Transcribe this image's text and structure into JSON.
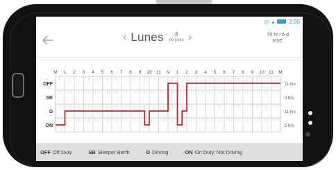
{
  "status_bar": {
    "time": "2:50",
    "icons": [
      "alarm-icon",
      "signal-icon",
      "battery-icon"
    ]
  },
  "header": {
    "day": "Lunes",
    "date_day": "8",
    "date_month": "de junio",
    "cycle_rule": "70 hr / 6 d",
    "timezone": "EST"
  },
  "log_chart": {
    "hour_labels": [
      "M",
      "1",
      "2",
      "3",
      "4",
      "5",
      "6",
      "7",
      "8",
      "9",
      "10",
      "11",
      "N",
      "1",
      "2",
      "3",
      "4",
      "5",
      "6",
      "7",
      "8",
      "9",
      "10",
      "11",
      "M"
    ],
    "row_labels": [
      "OFF",
      "SB",
      "D",
      "ON"
    ],
    "row_totals": [
      "11 hrs",
      "0 hrs",
      "11 hrs",
      "2 hrs"
    ],
    "status_segments": [
      {
        "status": "ON",
        "start": 0,
        "end": 1
      },
      {
        "status": "D",
        "start": 1,
        "end": 9.5
      },
      {
        "status": "ON",
        "start": 9.5,
        "end": 10
      },
      {
        "status": "D",
        "start": 10,
        "end": 12
      },
      {
        "status": "OFF",
        "start": 12,
        "end": 13
      },
      {
        "status": "ON",
        "start": 13,
        "end": 13.5
      },
      {
        "status": "D",
        "start": 13.5,
        "end": 14
      },
      {
        "status": "OFF",
        "start": 14,
        "end": 24
      }
    ],
    "line_color": "#c8232c"
  },
  "legend": [
    {
      "code": "OFF",
      "label": "Off Duty"
    },
    {
      "code": "SB",
      "label": "Sleeper Berth"
    },
    {
      "code": "D",
      "label": "Driving"
    },
    {
      "code": "ON",
      "label": "On Duty, Not Driving"
    }
  ]
}
